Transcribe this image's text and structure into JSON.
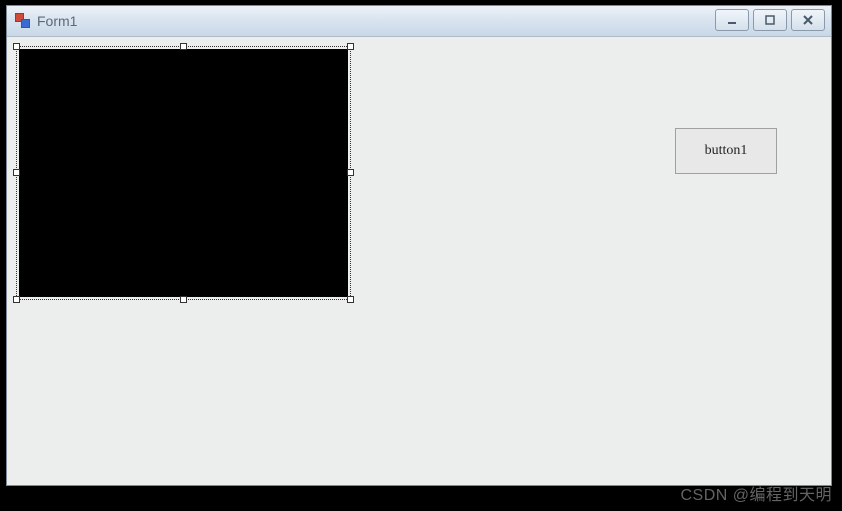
{
  "window": {
    "title": "Form1"
  },
  "controls": {
    "button1_label": "button1"
  },
  "watermark": "CSDN @编程到天明"
}
